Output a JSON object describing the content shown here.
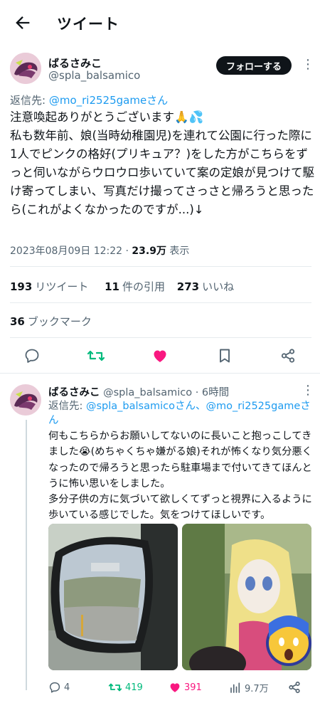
{
  "header": {
    "title": "ツイート"
  },
  "tweet": {
    "display_name": "ばるさみこ",
    "handle": "@spla_balsamico",
    "follow_label": "フォローする",
    "reply_prefix": "返信先: ",
    "reply_to": "@mo_ri2525gameさん",
    "lines": [
      "注意喚起ありがとうございます🙏💦",
      "私も数年前、娘(当時幼稚園児)を連れて公園に行った際に1人でピンクの格好(プリキュア？)をした方がこちらをずっと伺いながらウロウロ歩いていて案の定娘が見つけて駆け寄ってしまい、写真だけ撮ってさっさと帰ろうと思ったら(これがよくなかったのですが...)↓"
    ],
    "datetime": "2023年08月09日 12:22 · ",
    "views_count": "23.9万",
    "views_label": " 表示",
    "retweets_count": "193",
    "retweets_label": "リツイート",
    "quotes_count": "11",
    "quotes_label": "件の引用",
    "likes_count": "273",
    "likes_label": "いいね",
    "bookmarks_count": "36",
    "bookmarks_label": "ブックマーク"
  },
  "reply": {
    "display_name": "ばるさみこ",
    "handle": "@spla_balsamico",
    "time": " · 6時間",
    "reply_prefix": "返信先: ",
    "reply_to": "@spla_balsamicoさん、@mo_ri2525gameさん",
    "lines": [
      "何もこちらからお願いしてないのに長いこと抱っこしてきました😭(めちゃくちゃ嫌がる娘)それが怖くなり気分悪くなったので帰ろうと思ったら駐車場まで付いてきてほんとうに怖い思いをしました。",
      "多分子供の方に気づいて欲しくてずっと視界に入るように歩いている感じでした。気をつけてほしいです。"
    ],
    "replies": "4",
    "retweets": "419",
    "likes": "391",
    "views": "9.7万"
  },
  "colors": {
    "accent": "#1d9bf0",
    "retweet": "#00ba7c",
    "like": "#f91880",
    "muted": "#536471"
  }
}
